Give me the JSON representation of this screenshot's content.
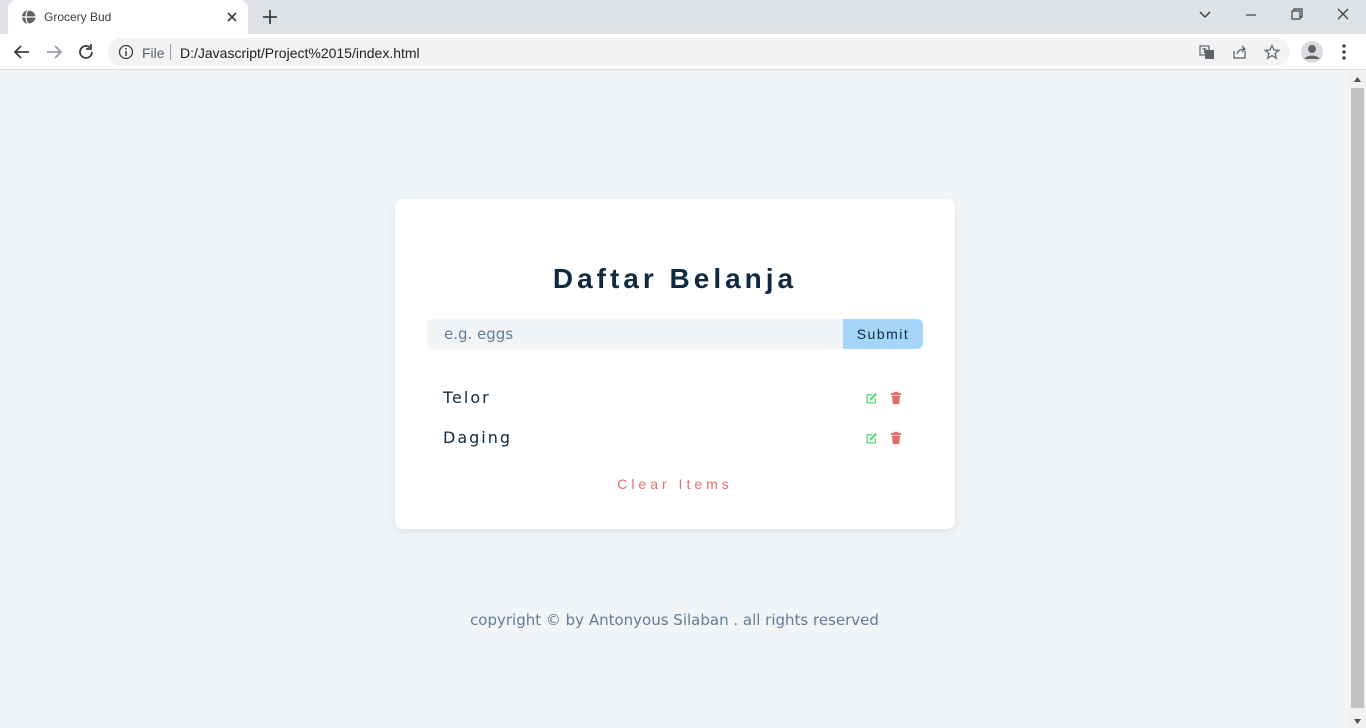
{
  "browser": {
    "tab_title": "Grocery Bud",
    "url_scheme": "File",
    "url": "D:/Javascript/Project%2015/index.html"
  },
  "app": {
    "title": "Daftar Belanja",
    "input_placeholder": "e.g. eggs",
    "input_value": "",
    "submit_label": "Submit",
    "items": [
      {
        "name": "Telor"
      },
      {
        "name": "Daging"
      }
    ],
    "clear_label": "Clear Items"
  },
  "footer": {
    "text": "copyright © by Antonyous Silaban . all rights reserved"
  },
  "colors": {
    "page_bg": "#f1f5f8",
    "title": "#102a42",
    "submit_bg": "#a5d5f8",
    "edit_icon": "#4ce26b",
    "delete_icon": "#e66b6b",
    "clear_text": "#e66b6b",
    "muted_text": "#617d98"
  },
  "icons": {
    "edit": "edit-icon",
    "delete": "trash-icon"
  }
}
